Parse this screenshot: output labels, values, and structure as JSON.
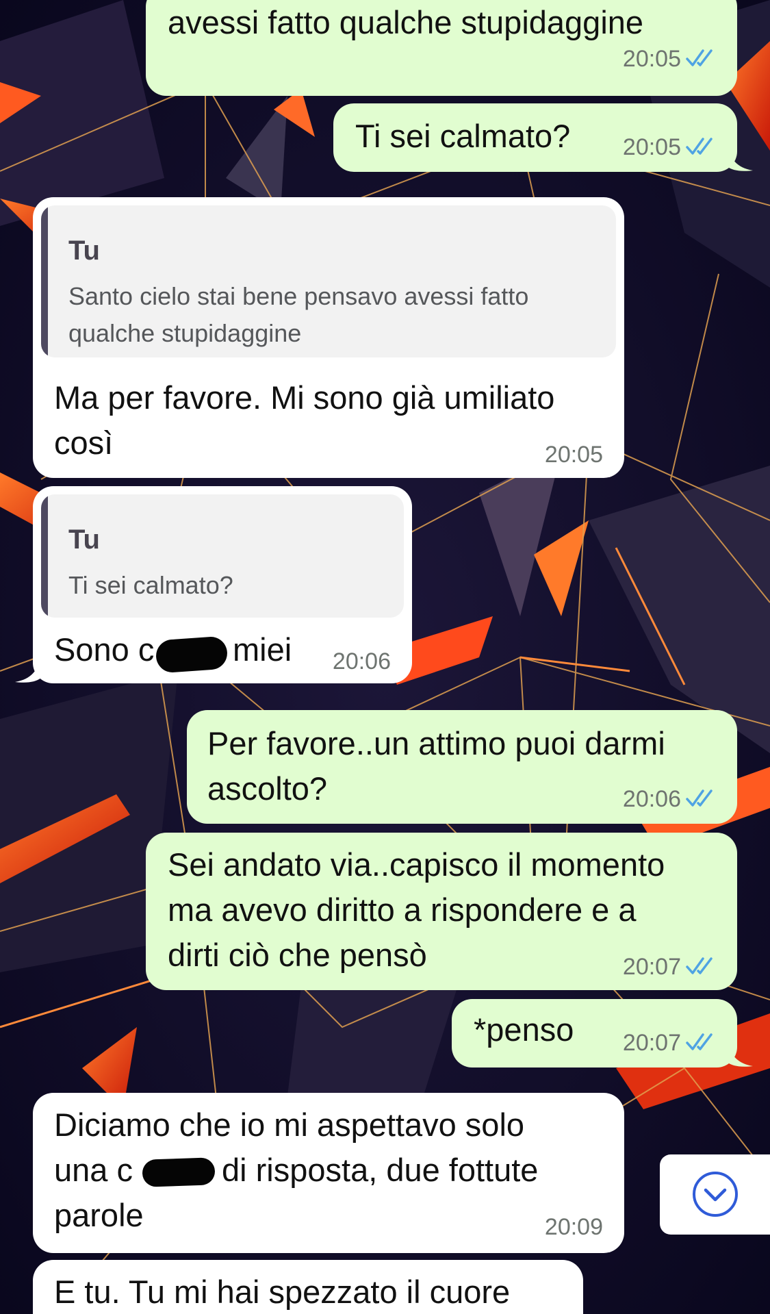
{
  "messages": [
    {
      "direction": "out",
      "lines": [
        "avessi fatto qualche stupidaggine"
      ],
      "time": "20:05",
      "read": true
    },
    {
      "direction": "out",
      "lines": [
        "Ti sei calmato?"
      ],
      "time": "20:05",
      "read": true
    },
    {
      "direction": "in",
      "reply_to": {
        "sender": "Tu",
        "lines": [
          "Santo cielo stai bene pensavo avessi fatto",
          "qualche stupidaggine"
        ]
      },
      "lines": [
        "Ma per favore. Mi sono già umiliato",
        "così"
      ],
      "time": "20:05"
    },
    {
      "direction": "in",
      "reply_to": {
        "sender": "Tu",
        "lines": [
          "Ti sei calmato?"
        ]
      },
      "lines": [
        "Sono c",
        "miei"
      ],
      "redacted": true,
      "time": "20:06"
    },
    {
      "direction": "out",
      "lines": [
        "Per favore..un attimo puoi darmi",
        "ascolto?"
      ],
      "time": "20:06",
      "read": true
    },
    {
      "direction": "out",
      "lines": [
        "Sei andato via..capisco il momento",
        "ma avevo diritto a rispondere e a",
        "dirti ciò che pensò"
      ],
      "time": "20:07",
      "read": true
    },
    {
      "direction": "out",
      "lines": [
        "*penso"
      ],
      "time": "20:07",
      "read": true
    },
    {
      "direction": "in",
      "lines": [
        "Diciamo che io mi aspettavo solo",
        "una c",
        "di risposta, due fottute",
        "parole"
      ],
      "redacted": true,
      "time": "20:09"
    },
    {
      "direction": "in",
      "lines": [
        "E tu. Tu mi hai spezzato il cuore"
      ]
    }
  ],
  "scroll_down_icon": "chevron-down-circle-icon",
  "colors": {
    "outgoing_bubble": "#e1fdd0",
    "incoming_bubble": "#ffffff",
    "quote_background": "#f2f2f2",
    "quote_bar": "#4e4960",
    "read_ticks": "#4fa3e3",
    "scroll_button_icon": "#2f5bd8",
    "wallpaper_dark": "#0d0a22",
    "wallpaper_accent": "#ff4a1c"
  }
}
